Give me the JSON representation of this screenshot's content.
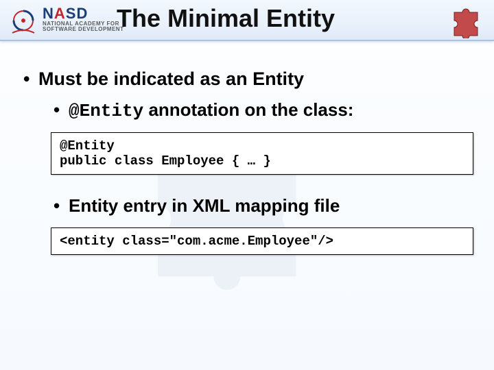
{
  "header": {
    "brand_main_1": "N",
    "brand_main_2": "A",
    "brand_main_3": "SD",
    "brand_sub1": "NATIONAL ACADEMY FOR",
    "brand_sub2": "SOFTWARE DEVELOPMENT",
    "title": "The Minimal Entity"
  },
  "bullet1": "Must be indicated as an Entity",
  "bullet2a_code": "@Entity",
  "bullet2a_rest": " annotation on the class:",
  "code1": "@Entity\npublic class Employee { … }",
  "bullet2b": "Entity entry in XML mapping file",
  "code2": "<entity class=\"com.acme.Employee\"/>"
}
